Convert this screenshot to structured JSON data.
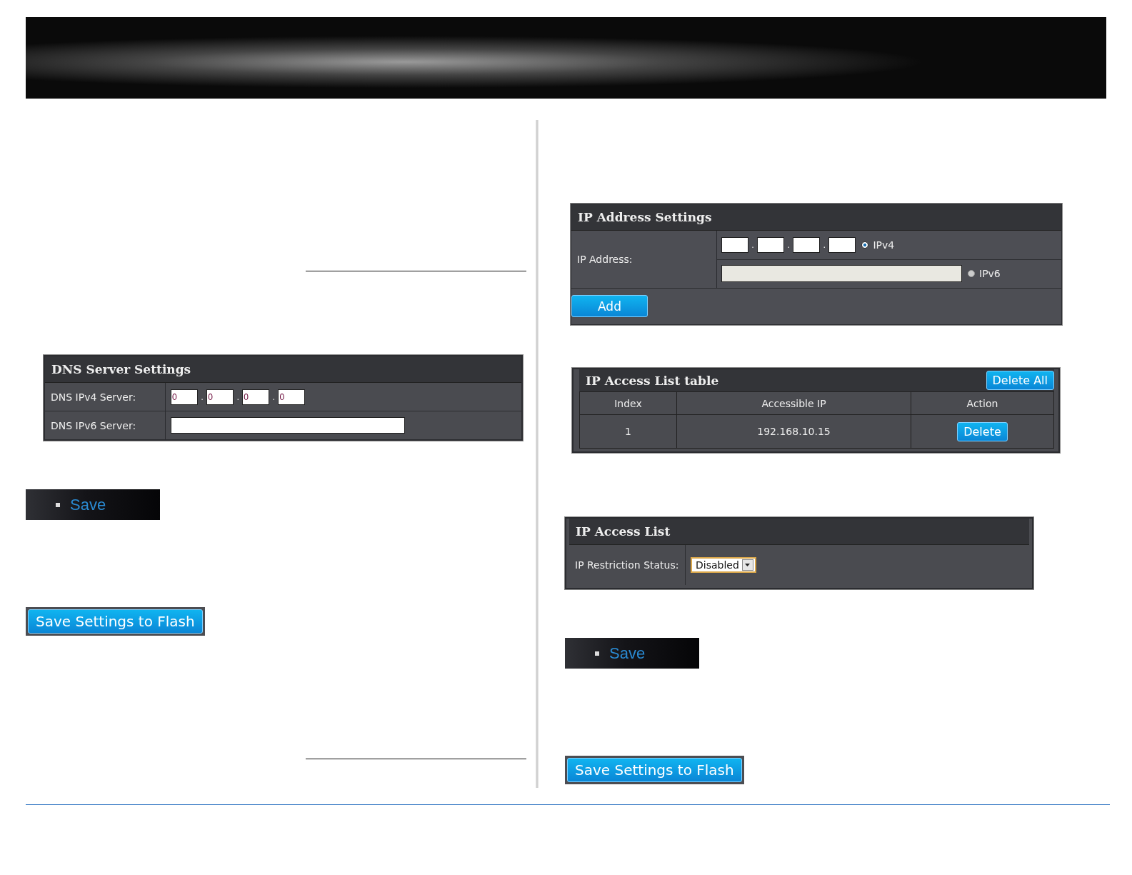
{
  "dns_settings": {
    "title": "DNS Server Settings",
    "rows": [
      {
        "kind": "ipv4",
        "label": "DNS IPv4 Server:",
        "octets": [
          "0",
          "0",
          "0",
          "0"
        ],
        "separator": "."
      },
      {
        "kind": "text",
        "label": "DNS IPv6 Server:"
      }
    ]
  },
  "left_save": {
    "label": "Save"
  },
  "left_flash": {
    "label": "Save Settings to Flash"
  },
  "ip_settings": {
    "title": "IP Address Settings",
    "label": "IP Address:",
    "separator": ".",
    "options": [
      {
        "kind": "ipv4",
        "label": "IPv4",
        "selected": true
      },
      {
        "kind": "ipv6",
        "label": "IPv6",
        "selected": false
      }
    ],
    "add_button": "Add"
  },
  "access_table": {
    "title": "IP Access List table",
    "delete_all": "Delete All",
    "columns": [
      "Index",
      "Accessible IP",
      "Action"
    ],
    "rows": [
      {
        "index": "1",
        "ip": "192.168.10.15",
        "action": "Delete"
      }
    ]
  },
  "access_list": {
    "title": "IP Access List",
    "label": "IP Restriction Status:",
    "value": "Disabled"
  },
  "right_save": {
    "label": "Save"
  },
  "right_flash": {
    "label": "Save Settings to Flash"
  }
}
